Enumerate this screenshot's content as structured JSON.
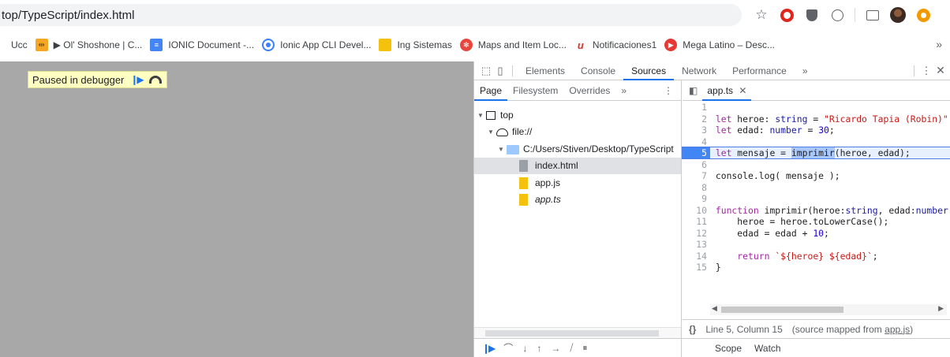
{
  "address": {
    "url": "top/TypeScript/index.html"
  },
  "toolbar_icons": [
    "star-icon",
    "opera-icon",
    "shield-icon",
    "circle-extension-icon",
    "cast-icon",
    "profile-avatar",
    "orange-extension-icon"
  ],
  "bookmarks": [
    {
      "label": "Ucc",
      "icon": "",
      "color": ""
    },
    {
      "label": "▶ Ol' Shoshone | C...",
      "icon": "yt-icon",
      "color": "#f5a623"
    },
    {
      "label": "IONIC Document -...",
      "icon": "doc-icon",
      "color": "#4285f4"
    },
    {
      "label": "Ionic App CLI Devel...",
      "icon": "ionic-icon",
      "color": "#3880ff"
    },
    {
      "label": "Ing Sistemas",
      "icon": "folder-icon",
      "color": "#f4c20d"
    },
    {
      "label": "Maps and Item Loc...",
      "icon": "maps-icon",
      "color": "#e8463c"
    },
    {
      "label": "Notificaciones1",
      "icon": "notif-icon",
      "color": "#d93025"
    },
    {
      "label": "Mega Latino – Desc...",
      "icon": "mega-icon",
      "color": "#e53935"
    }
  ],
  "bookmarks_more": "»",
  "page": {
    "paused_label": "Paused in debugger"
  },
  "devtools": {
    "tabs": [
      "Elements",
      "Console",
      "Sources",
      "Network",
      "Performance",
      "»"
    ],
    "active_tab": "Sources",
    "navigator_tabs": [
      "Page",
      "Filesystem",
      "Overrides",
      "»"
    ],
    "tree": {
      "top": "top",
      "origin": "file://",
      "folder": "C:/Users/Stiven/Desktop/TypeScript",
      "files": [
        "index.html",
        "app.js",
        "app.ts"
      ]
    },
    "editor_tab": "app.ts",
    "code": [
      {
        "n": "1",
        "t": ""
      },
      {
        "n": "2",
        "t": "let heroe: string = \"Ricardo Tapia (Robin)\";"
      },
      {
        "n": "3",
        "t": "let edad: number = 30;"
      },
      {
        "n": "4",
        "t": ""
      },
      {
        "n": "5",
        "t": "let mensaje = imprimir(heroe, edad);"
      },
      {
        "n": "6",
        "t": ""
      },
      {
        "n": "7",
        "t": "console.log( mensaje );"
      },
      {
        "n": "8",
        "t": ""
      },
      {
        "n": "9",
        "t": ""
      },
      {
        "n": "10",
        "t": "function imprimir(heroe:string, edad:number"
      },
      {
        "n": "11",
        "t": "    heroe = heroe.toLowerCase();"
      },
      {
        "n": "12",
        "t": "    edad = edad + 10;"
      },
      {
        "n": "13",
        "t": ""
      },
      {
        "n": "14",
        "t": "    return `${heroe} ${edad}`;"
      },
      {
        "n": "15",
        "t": "}"
      }
    ],
    "status": {
      "braces": "{}",
      "position": "Line 5, Column 15",
      "mapped_prefix": "(source mapped from ",
      "mapped_link": "app.js",
      "mapped_suffix": ")"
    },
    "scope_tabs": [
      "Scope",
      "Watch"
    ]
  }
}
